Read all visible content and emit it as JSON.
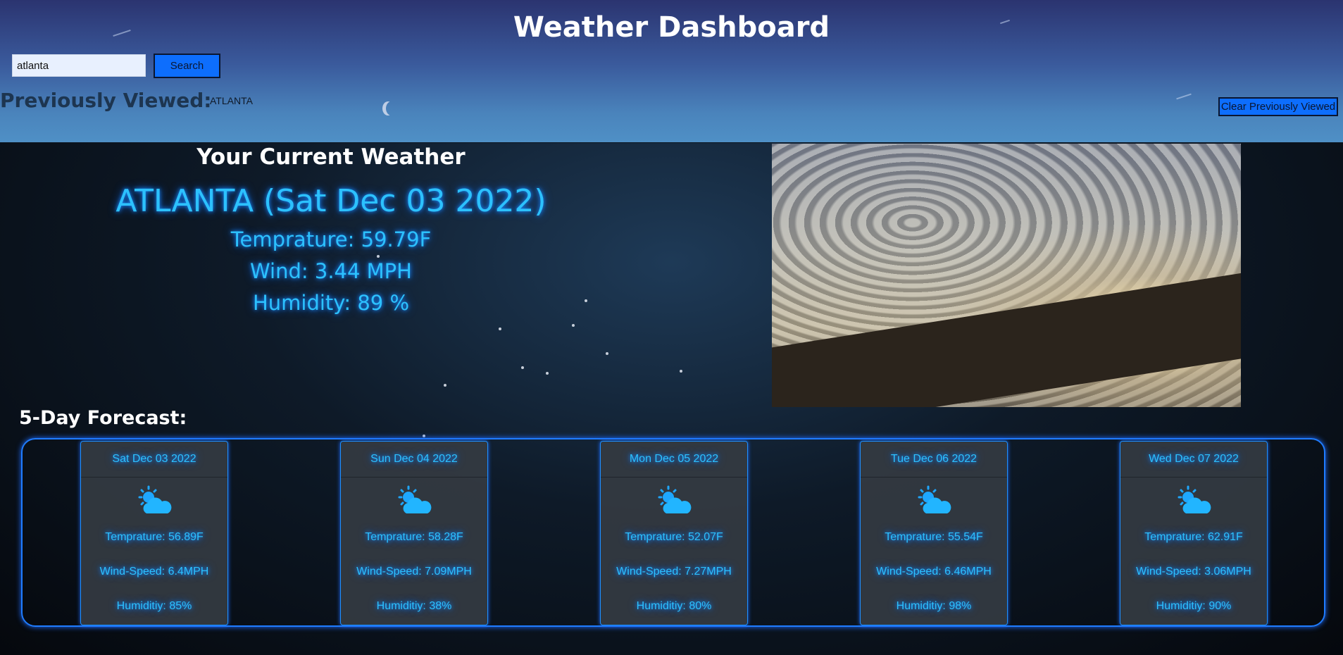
{
  "header": {
    "title": "Weather Dashboard",
    "search": {
      "value": "atlanta",
      "button_label": "Search"
    },
    "previously_viewed": {
      "label": "Previously Viewed:",
      "items": [
        "ATLANTA"
      ]
    },
    "clear_label": "Clear Previously Viewed"
  },
  "current": {
    "heading": "Your Current Weather",
    "city_date": "ATLANTA (Sat Dec 03 2022)",
    "temperature": "Temprature: 59.79F",
    "wind": "Wind: 3.44 MPH",
    "humidity": "Humidity: 89 %"
  },
  "forecast": {
    "title": "5-Day Forecast:",
    "days": [
      {
        "date": "Sat Dec 03 2022",
        "icon": "partly-cloudy-icon",
        "temp": "Temprature: 56.89F",
        "wind": "Wind-Speed: 6.4MPH",
        "humidity": "Humiditiy: 85%"
      },
      {
        "date": "Sun Dec 04 2022",
        "icon": "partly-cloudy-icon",
        "temp": "Temprature: 58.28F",
        "wind": "Wind-Speed: 7.09MPH",
        "humidity": "Humiditiy: 38%"
      },
      {
        "date": "Mon Dec 05 2022",
        "icon": "partly-cloudy-icon",
        "temp": "Temprature: 52.07F",
        "wind": "Wind-Speed: 7.27MPH",
        "humidity": "Humiditiy: 80%"
      },
      {
        "date": "Tue Dec 06 2022",
        "icon": "partly-cloudy-icon",
        "temp": "Temprature: 55.54F",
        "wind": "Wind-Speed: 6.46MPH",
        "humidity": "Humiditiy: 98%"
      },
      {
        "date": "Wed Dec 07 2022",
        "icon": "partly-cloudy-icon",
        "temp": "Temprature: 62.91F",
        "wind": "Wind-Speed: 3.06MPH",
        "humidity": "Humiditiy: 90%"
      }
    ]
  },
  "colors": {
    "accent": "#2cc1ff",
    "button": "#0d6efd",
    "card_border": "#1e90ff"
  }
}
